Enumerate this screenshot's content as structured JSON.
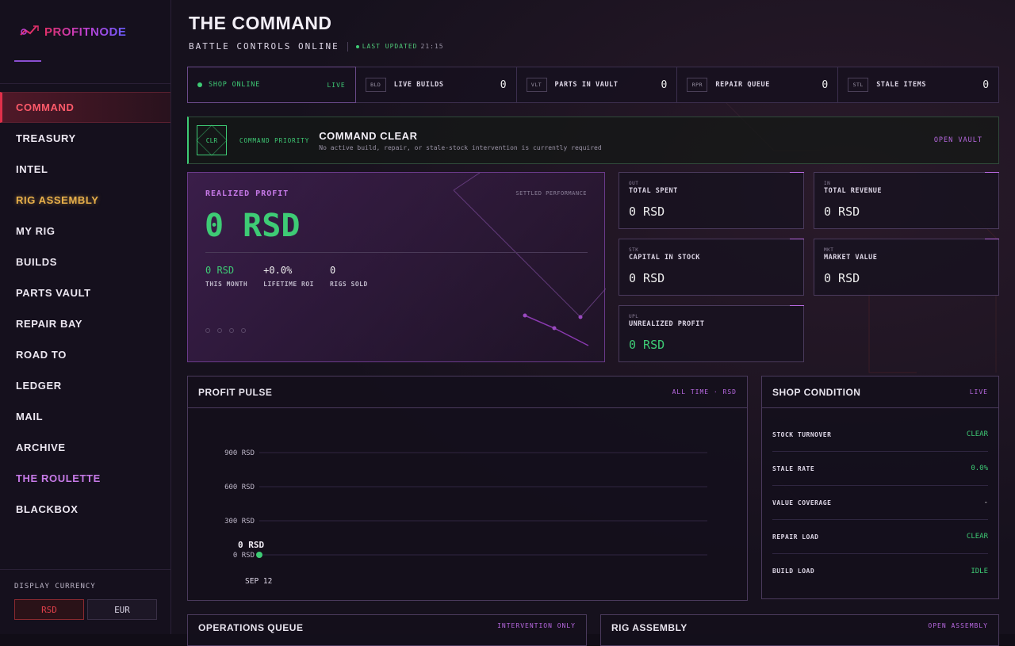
{
  "app": {
    "logo": "PROFITNODE"
  },
  "sidebar": {
    "items": [
      {
        "label": "COMMAND"
      },
      {
        "label": "TREASURY"
      },
      {
        "label": "INTEL"
      },
      {
        "label": "RIG ASSEMBLY"
      },
      {
        "label": "MY RIG"
      },
      {
        "label": "BUILDS"
      },
      {
        "label": "PARTS VAULT"
      },
      {
        "label": "REPAIR BAY"
      },
      {
        "label": "ROAD TO"
      },
      {
        "label": "LEDGER"
      },
      {
        "label": "MAIL"
      },
      {
        "label": "ARCHIVE"
      },
      {
        "label": "THE ROULETTE"
      },
      {
        "label": "BLACKBOX"
      }
    ],
    "currency": {
      "label": "DISPLAY CURRENCY",
      "options": [
        "RSD",
        "EUR"
      ],
      "selected": "RSD"
    }
  },
  "header": {
    "title": "THE COMMAND",
    "subtitle": "BATTLE CONTROLS ONLINE",
    "updated_label": "LAST UPDATED",
    "updated_time": "21:15"
  },
  "statusbar": {
    "shop": {
      "label": "SHOP ONLINE",
      "status": "LIVE"
    },
    "cells": [
      {
        "tag": "BLD",
        "label": "LIVE BUILDS",
        "value": "0"
      },
      {
        "tag": "VLT",
        "label": "PARTS IN VAULT",
        "value": "0"
      },
      {
        "tag": "RPR",
        "label": "REPAIR QUEUE",
        "value": "0"
      },
      {
        "tag": "STL",
        "label": "STALE ITEMS",
        "value": "0"
      }
    ]
  },
  "priority": {
    "code": "CLR",
    "tag": "COMMAND PRIORITY",
    "title": "COMMAND CLEAR",
    "desc": "No active build, repair, or stale-stock intervention is currently required",
    "action": "OPEN VAULT"
  },
  "profit": {
    "label": "REALIZED PROFIT",
    "note": "SETTLED PERFORMANCE",
    "value": "0 RSD",
    "stats": [
      {
        "value": "0 RSD",
        "label": "THIS MONTH"
      },
      {
        "value": "+0.0%",
        "label": "LIFETIME ROI"
      },
      {
        "value": "0",
        "label": "RIGS SOLD"
      }
    ]
  },
  "minis": [
    {
      "code": "OUT",
      "label": "TOTAL SPENT",
      "value": "0 RSD"
    },
    {
      "code": "IN",
      "label": "TOTAL REVENUE",
      "value": "0 RSD"
    },
    {
      "code": "STK",
      "label": "CAPITAL IN STOCK",
      "value": "0 RSD"
    },
    {
      "code": "MKT",
      "label": "MARKET VALUE",
      "value": "0 RSD"
    },
    {
      "code": "UPL",
      "label": "UNREALIZED PROFIT",
      "value": "0 RSD"
    }
  ],
  "pulse": {
    "title": "PROFIT PULSE",
    "tag": "ALL TIME · RSD",
    "point_label": "0 RSD"
  },
  "chart_data": {
    "type": "line",
    "x": [
      "SEP 12"
    ],
    "series": [
      {
        "values": [
          0
        ]
      }
    ],
    "y_ticks": [
      "0 RSD",
      "300 RSD",
      "600 RSD",
      "900 RSD"
    ],
    "y_tick_values": [
      0,
      300,
      600,
      900
    ],
    "ylim": [
      0,
      900
    ],
    "grid": true,
    "colors": {
      "line": "#3ecb75",
      "grid": "#2f2640"
    }
  },
  "condition": {
    "title": "SHOP CONDITION",
    "tag": "LIVE",
    "rows": [
      {
        "label": "STOCK TURNOVER",
        "value": "CLEAR"
      },
      {
        "label": "STALE RATE",
        "value": "0.0%"
      },
      {
        "label": "VALUE COVERAGE",
        "value": "-"
      },
      {
        "label": "REPAIR LOAD",
        "value": "CLEAR"
      },
      {
        "label": "BUILD LOAD",
        "value": "IDLE"
      }
    ]
  },
  "bottom": {
    "queue": {
      "title": "OPERATIONS QUEUE",
      "tag": "INTERVENTION ONLY"
    },
    "assembly": {
      "title": "RIG ASSEMBLY",
      "tag": "OPEN ASSEMBLY"
    }
  },
  "colors": {
    "accent": "#b768e0",
    "positive": "#3ecb75",
    "alert": "#e0304a",
    "gold": "#e8b04a"
  }
}
